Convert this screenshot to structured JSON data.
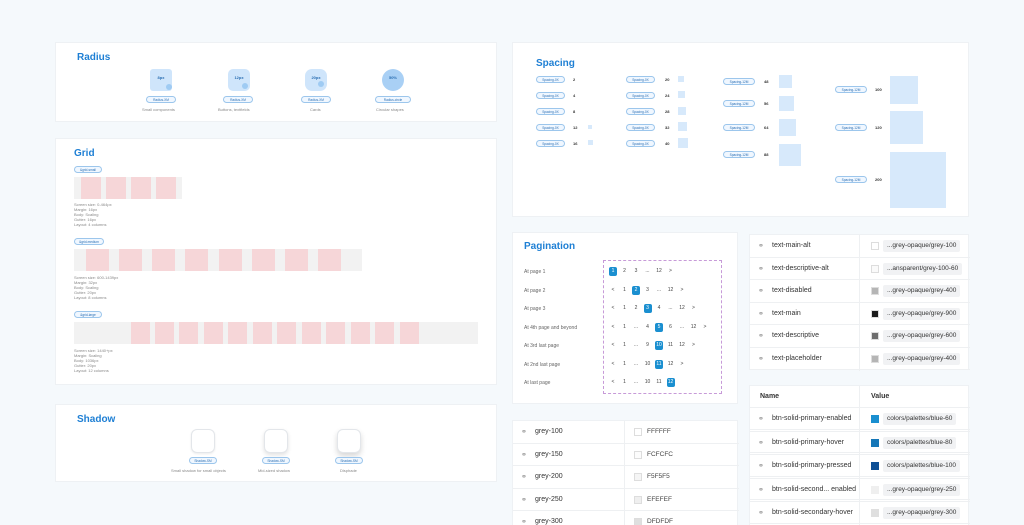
{
  "radius": {
    "title": "Radius",
    "items": [
      {
        "value": "8px",
        "pill": "Radius-XM",
        "caption": "Small components"
      },
      {
        "value": "12px",
        "pill": "Radius-XM",
        "caption": "Buttons, textfields"
      },
      {
        "value": "20px",
        "pill": "Radius-XM",
        "caption": "Cards"
      },
      {
        "value": "50%",
        "pill": "Radius-circle",
        "caption": "Circular shapes"
      }
    ]
  },
  "grid": {
    "title": "Grid",
    "small": {
      "pill": "&grid-small",
      "text": [
        "Screen size: 0-464px",
        "Margin: 16px",
        "Body: Scaling",
        "Gutter: 16px",
        "Layout: 4 columns"
      ]
    },
    "medium": {
      "pill": "&grid-medium",
      "text": [
        "Screen size: 600-1439px",
        "Margin: 32px",
        "Body: Scaling",
        "Gutter: 20px",
        "Layout: 8 columns"
      ]
    },
    "large": {
      "pill": "&grid-large",
      "text": [
        "Screen size: 1440+px",
        "Margin: Scaling",
        "Body: 1036px",
        "Gutter: 20px",
        "Layout: 12 columns"
      ]
    }
  },
  "shadow": {
    "title": "Shadow",
    "items": [
      {
        "pill": "Shadow-SM",
        "caption": "Small shadow for small objects"
      },
      {
        "pill": "Shadow-SM",
        "caption": "Mid-sized shadow"
      },
      {
        "pill": "Shadow-SM",
        "caption": "Disphade"
      }
    ]
  },
  "spacing": {
    "title": "Spacing",
    "col1": [
      {
        "pill": "Spacing-0X",
        "value": "2"
      },
      {
        "pill": "Spacing-0X",
        "value": "4"
      },
      {
        "pill": "Spacing-0X",
        "value": "8"
      },
      {
        "pill": "Spacing-0X",
        "value": "12"
      },
      {
        "pill": "Spacing-0X",
        "value": "16"
      }
    ],
    "col2": [
      {
        "pill": "Spacing-0X",
        "value": "20"
      },
      {
        "pill": "Spacing-0X",
        "value": "24"
      },
      {
        "pill": "Spacing-0X",
        "value": "28"
      },
      {
        "pill": "Spacing-0X",
        "value": "32"
      },
      {
        "pill": "Spacing-0X",
        "value": "40"
      }
    ],
    "col3": [
      {
        "pill": "Spacing-12M",
        "value": "48"
      },
      {
        "pill": "Spacing-12M",
        "value": "56"
      },
      {
        "pill": "Spacing-12M",
        "value": "64"
      },
      {
        "pill": "Spacing-12M",
        "value": "88"
      }
    ],
    "col4": [
      {
        "pill": "Spacing-12M",
        "value": "100"
      },
      {
        "pill": "Spacing-12M",
        "value": "120"
      },
      {
        "pill": "Spacing-12M",
        "value": "200"
      }
    ]
  },
  "pagination": {
    "title": "Pagination",
    "rows": [
      {
        "label": "At page 1",
        "items": [
          "1",
          "2",
          "3",
          "...",
          "12",
          ">"
        ],
        "selected": 0
      },
      {
        "label": "At page 2",
        "items": [
          "<",
          "1",
          "2",
          "3",
          "...",
          "12",
          ">"
        ],
        "selected": 2
      },
      {
        "label": "At page 3",
        "items": [
          "<",
          "1",
          "2",
          "3",
          "4",
          "...",
          "12",
          ">"
        ],
        "selected": 3
      },
      {
        "label": "At 4th page and beyond",
        "items": [
          "<",
          "1",
          "...",
          "4",
          "5",
          "6",
          "...",
          "12",
          ">"
        ],
        "selected": 4
      },
      {
        "label": "At 3rd last page",
        "items": [
          "<",
          "1",
          "...",
          "9",
          "10",
          "11",
          "12",
          ">"
        ],
        "selected": 4
      },
      {
        "label": "At 2nd last page",
        "items": [
          "<",
          "1",
          "...",
          "10",
          "11",
          "12",
          ">"
        ],
        "selected": 4
      },
      {
        "label": "At last page",
        "items": [
          "<",
          "1",
          "...",
          "10",
          "11",
          "12"
        ],
        "selected": 5
      }
    ]
  },
  "greys": [
    {
      "name": "grey-100",
      "hex": "FFFFFF",
      "color": "#FFFFFF"
    },
    {
      "name": "grey-150",
      "hex": "FCFCFC",
      "color": "#FCFCFC"
    },
    {
      "name": "grey-200",
      "hex": "F5F5F5",
      "color": "#F5F5F5"
    },
    {
      "name": "grey-250",
      "hex": "EFEFEF",
      "color": "#EFEFEF"
    },
    {
      "name": "grey-300",
      "hex": "DFDFDF",
      "color": "#DFDFDF"
    }
  ],
  "text_tokens": [
    {
      "name": "text-main-alt",
      "value": "...grey-opaque/grey-100",
      "color": "#FFFFFF"
    },
    {
      "name": "text-descriptive-alt",
      "value": "...ansparent/grey-100-60",
      "color": "#FAFAFA"
    },
    {
      "name": "text-disabled",
      "value": "...grey-opaque/grey-400",
      "color": "#B5B5B5"
    },
    {
      "name": "text-main",
      "value": "...grey-opaque/grey-900",
      "color": "#1A1A1A"
    },
    {
      "name": "text-descriptive",
      "value": "...grey-opaque/grey-600",
      "color": "#6E6E6E"
    },
    {
      "name": "text-placeholder",
      "value": "...grey-opaque/grey-400",
      "color": "#B5B5B5"
    }
  ],
  "btn_tokens": {
    "header_name": "Name",
    "header_value": "Value",
    "rows": [
      {
        "name": "btn-solid-primary-enabled",
        "value": "colors/palettes/blue-60",
        "color": "#1A8FD0"
      },
      {
        "name": "btn-solid-primary-hover",
        "value": "colors/palettes/blue-80",
        "color": "#1577B8"
      },
      {
        "name": "btn-solid-primary-pressed",
        "value": "colors/palettes/blue-100",
        "color": "#0E4F95"
      },
      {
        "name": "btn-solid-second... enabled",
        "value": "...grey-opaque/grey-250",
        "color": "#EFEFEF"
      },
      {
        "name": "btn-solid-secondary-hover",
        "value": "...grey-opaque/grey-300",
        "color": "#DFDFDF"
      }
    ]
  }
}
